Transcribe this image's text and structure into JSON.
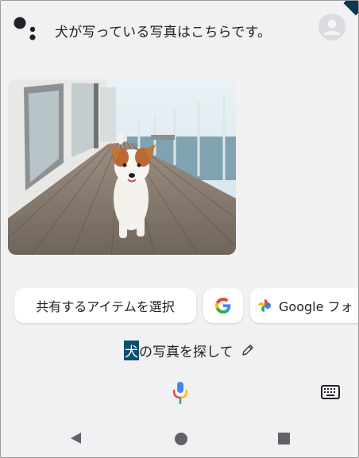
{
  "assistant": {
    "title": "犬が写っている写真はこちらです。",
    "logo_colors": [
      "#202124",
      "#202124",
      "#202124"
    ]
  },
  "photo": {
    "subject": "dog-photo"
  },
  "chips": {
    "share": "共有するアイテムを選択",
    "google": "G",
    "photos": "Google フォ"
  },
  "query": {
    "highlighted": "犬",
    "rest": "の写真を探して"
  },
  "colors": {
    "background": "#f1f1f3",
    "highlight": "#0b4f6c",
    "google_blue": "#4285F4",
    "google_red": "#EA4335",
    "google_yellow": "#FBBC05",
    "google_green": "#34A853"
  }
}
